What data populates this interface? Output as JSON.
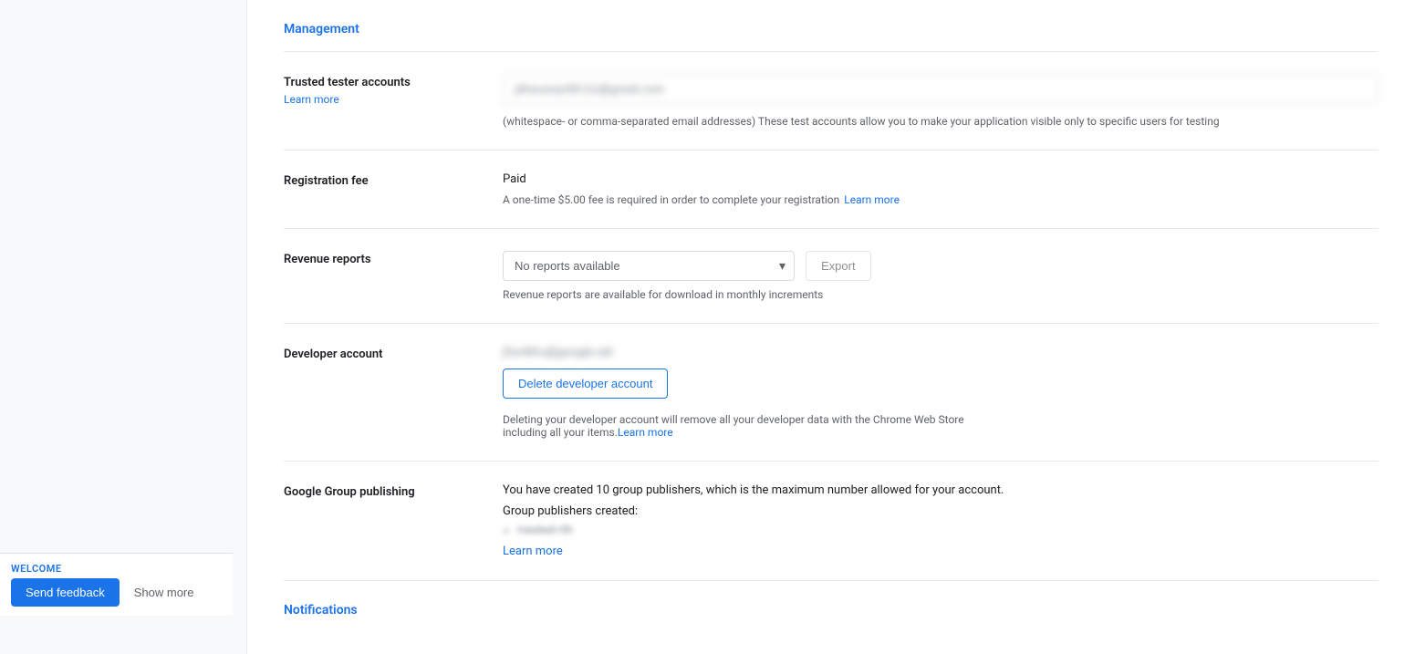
{
  "sidebar": {
    "welcome_label": "WELCOME",
    "send_feedback_label": "Send feedback",
    "show_more_label": "Show more"
  },
  "management_section": {
    "heading": "Management",
    "trusted_tester": {
      "label": "Trusted tester accounts",
      "learn_more": "Learn more",
      "input_value": "jdheusnpr98 k1i@gmail.com",
      "hint": "(whitespace- or comma-separated email addresses) These test accounts allow you to make your application visible only to specific users for testing"
    },
    "registration_fee": {
      "label": "Registration fee",
      "status": "Paid",
      "description": "A one-time $5.00 fee is required in order to complete your registration",
      "learn_more": "Learn more"
    },
    "revenue_reports": {
      "label": "Revenue reports",
      "select_value": "No reports available",
      "export_label": "Export",
      "hint": "Revenue reports are available for download in monthly increments"
    },
    "developer_account": {
      "label": "Developer account",
      "email_blurred": "jfun4ltru@google.rali",
      "delete_button": "Delete developer account",
      "description": "Deleting your developer account will remove all your developer data with the Chrome Web Store including all your items.",
      "learn_more": "Learn more"
    },
    "google_group_publishing": {
      "label": "Google Group publishing",
      "description": "You have created 10 group publishers, which is the maximum number allowed for your account.",
      "publishers_created_label": "Group publishers created:",
      "publisher_item": "rrested-rth",
      "learn_more": "Learn more"
    }
  },
  "notifications_section": {
    "heading": "Notifications"
  }
}
